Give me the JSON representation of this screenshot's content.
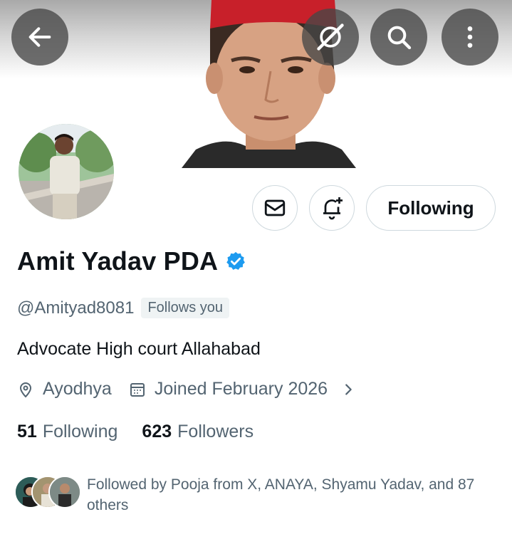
{
  "header": {
    "back_icon": "arrow-left-icon",
    "grok_icon": "grok-icon",
    "search_icon": "search-icon",
    "more_icon": "more-vertical-icon"
  },
  "profile": {
    "display_name": "Amit Yadav PDA",
    "verified": true,
    "handle": "@Amityad8081",
    "follows_you": "Follows you",
    "bio": "Advocate High court Allahabad",
    "location": "Ayodhya",
    "joined": "Joined February 2026",
    "following_count": "51",
    "following_label": "Following",
    "followers_count": "623",
    "followers_label": "Followers"
  },
  "actions": {
    "message_icon": "envelope-icon",
    "notify_icon": "bell-plus-icon",
    "following_button": "Following"
  },
  "followed_by": {
    "text": "Followed by Pooja from X, ANAYA, Shyamu Yadav, and 87 others"
  },
  "colors": {
    "verified_blue": "#1d9bf0",
    "secondary_text": "#536471",
    "primary_text": "#0f1419",
    "border": "#cfd9de"
  }
}
